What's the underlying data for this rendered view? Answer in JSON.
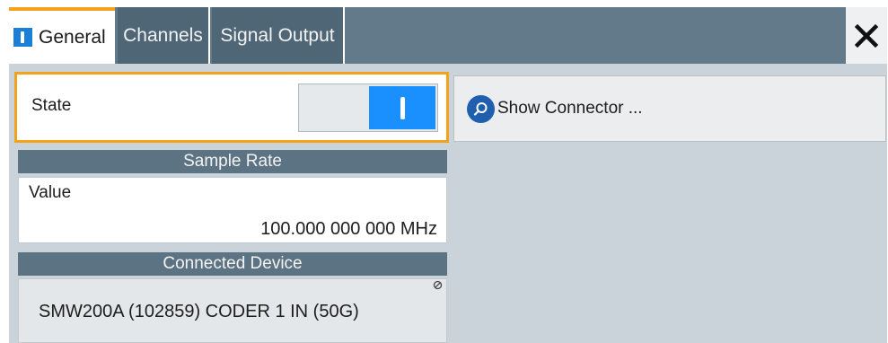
{
  "tabs": [
    {
      "label": "General",
      "active": true
    },
    {
      "label": "Channels",
      "active": false
    },
    {
      "label": "Signal Output",
      "active": false
    }
  ],
  "colors": {
    "accent": "#f2a31b",
    "toggle_on": "#1a90ff",
    "header_bg": "#5c7383"
  },
  "state": {
    "label": "State",
    "value": "on"
  },
  "show_connector": {
    "label": "Show Connector ...",
    "icon": "magnifier-icon"
  },
  "sample_rate": {
    "header": "Sample Rate",
    "field_label": "Value",
    "value": "100.000 000 000 MHz"
  },
  "connected_device": {
    "header": "Connected Device",
    "value": "SMW200A (102859) CODER 1 IN (50G)"
  }
}
